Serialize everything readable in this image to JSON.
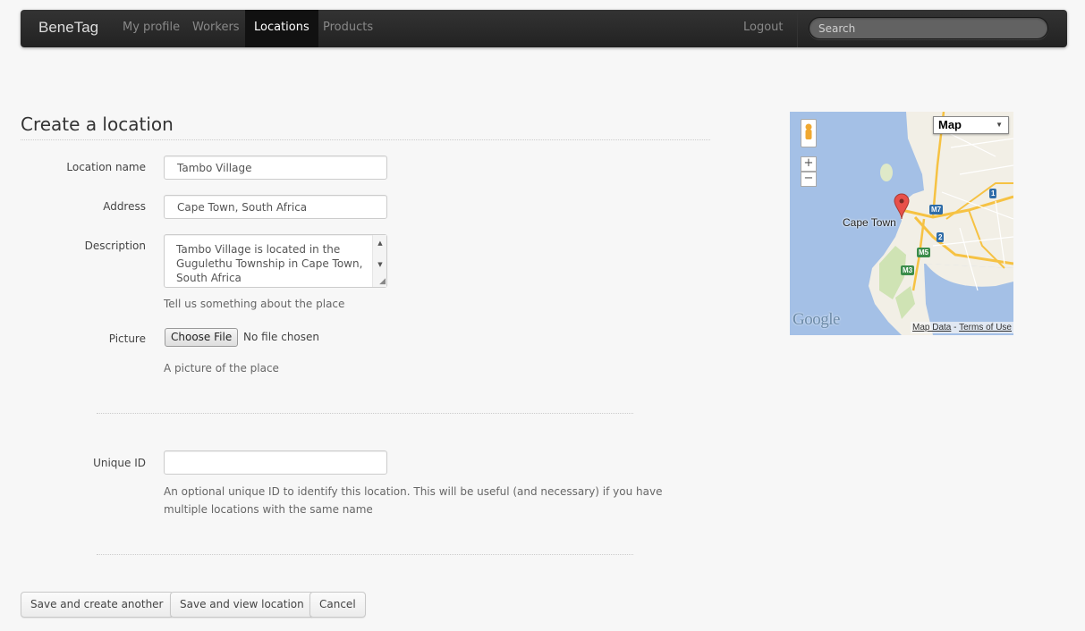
{
  "navbar": {
    "brand": "BeneTag",
    "items": [
      {
        "label": "My profile",
        "active": false
      },
      {
        "label": "Workers",
        "active": false
      },
      {
        "label": "Locations",
        "active": true
      },
      {
        "label": "Products",
        "active": false
      }
    ],
    "logout": "Logout",
    "search_placeholder": "Search"
  },
  "form": {
    "title": "Create a location",
    "location_name": {
      "label": "Location name",
      "value": "Tambo Village"
    },
    "address": {
      "label": "Address",
      "value": "Cape Town, South Africa"
    },
    "description": {
      "label": "Description",
      "value": "Tambo Village is located in the Gugulethu Township in Cape Town, South Africa",
      "help": "Tell us something about the place"
    },
    "picture": {
      "label": "Picture",
      "button": "Choose File",
      "status": "No file chosen",
      "help": "A picture of the place"
    },
    "unique_id": {
      "label": "Unique ID",
      "value": "",
      "help_line1": "An optional unique ID to identify this location. This will be useful (and necessary) if you have",
      "help_line2": "multiple locations with the same name"
    },
    "buttons": {
      "save_another": "Save and create another",
      "save_view": "Save and view location",
      "cancel": "Cancel"
    }
  },
  "map": {
    "type_selector": "Map",
    "city_label": "Cape Town",
    "zoom_in": "+",
    "zoom_out": "−",
    "logo": "Google",
    "map_data": "Map Data",
    "terms": "Terms of Use",
    "separator": " - ",
    "route_shields": [
      "M7",
      "2",
      "1",
      "M5",
      "M3"
    ],
    "colors": {
      "water": "#a4c0e6",
      "land": "#f2efe6",
      "park": "#cfe3b4",
      "highway": "#f6c243",
      "marker": "#e8504a"
    }
  }
}
